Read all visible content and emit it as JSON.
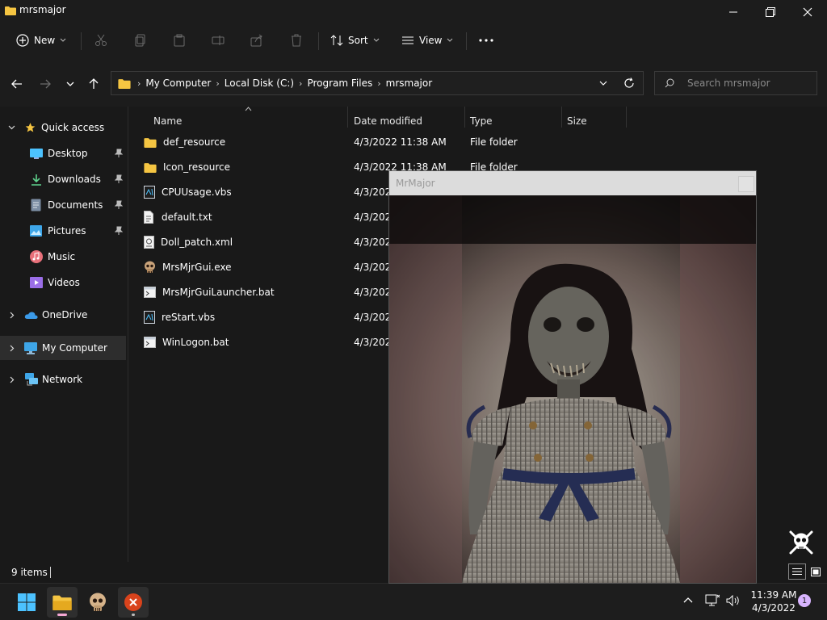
{
  "window": {
    "title": "mrsmajor"
  },
  "toolbar": {
    "new_label": "New",
    "sort_label": "Sort",
    "view_label": "View"
  },
  "breadcrumb": [
    "My Computer",
    "Local Disk (C:)",
    "Program Files",
    "mrsmajor"
  ],
  "search": {
    "placeholder": "Search mrsmajor"
  },
  "nav": {
    "quick_access": "Quick access",
    "items": [
      {
        "label": "Desktop",
        "icon": "desktop-icon",
        "pinned": true
      },
      {
        "label": "Downloads",
        "icon": "download-icon",
        "pinned": true
      },
      {
        "label": "Documents",
        "icon": "document-icon",
        "pinned": true
      },
      {
        "label": "Pictures",
        "icon": "picture-icon",
        "pinned": true
      },
      {
        "label": "Music",
        "icon": "music-icon",
        "pinned": false
      },
      {
        "label": "Videos",
        "icon": "video-icon",
        "pinned": false
      }
    ],
    "onedrive": "OneDrive",
    "my_computer": "My Computer",
    "network": "Network"
  },
  "columns": {
    "name": "Name",
    "date": "Date modified",
    "type": "Type",
    "size": "Size"
  },
  "files": [
    {
      "name": "def_resource",
      "icon": "folder-icon",
      "date": "4/3/2022 11:38 AM",
      "type": "File folder"
    },
    {
      "name": "Icon_resource",
      "icon": "folder-icon",
      "date": "4/3/2022 11:38 AM",
      "type": "File folder"
    },
    {
      "name": "CPUUsage.vbs",
      "icon": "script-icon",
      "date": "4/3/2022",
      "type": ""
    },
    {
      "name": "default.txt",
      "icon": "text-file-icon",
      "date": "4/3/2022",
      "type": ""
    },
    {
      "name": "Doll_patch.xml",
      "icon": "xml-file-icon",
      "date": "4/3/2022",
      "type": ""
    },
    {
      "name": "MrsMjrGui.exe",
      "icon": "skull-icon",
      "date": "4/3/2022",
      "type": ""
    },
    {
      "name": "MrsMjrGuiLauncher.bat",
      "icon": "batch-file-icon",
      "date": "4/3/2022",
      "type": ""
    },
    {
      "name": "reStart.vbs",
      "icon": "script-icon",
      "date": "4/3/2022",
      "type": ""
    },
    {
      "name": "WinLogon.bat",
      "icon": "batch-file-icon",
      "date": "4/3/2022",
      "type": ""
    }
  ],
  "status": {
    "item_count": "9 items"
  },
  "popup": {
    "title": "MrMajor"
  },
  "clock": {
    "time": "11:39 AM",
    "date": "4/3/2022"
  },
  "notifications": {
    "count": "1"
  },
  "colors": {
    "folder": "#f5c542",
    "accent": "#4cc2ff",
    "badge": "#d8b4fe",
    "error": "#d9431c"
  }
}
